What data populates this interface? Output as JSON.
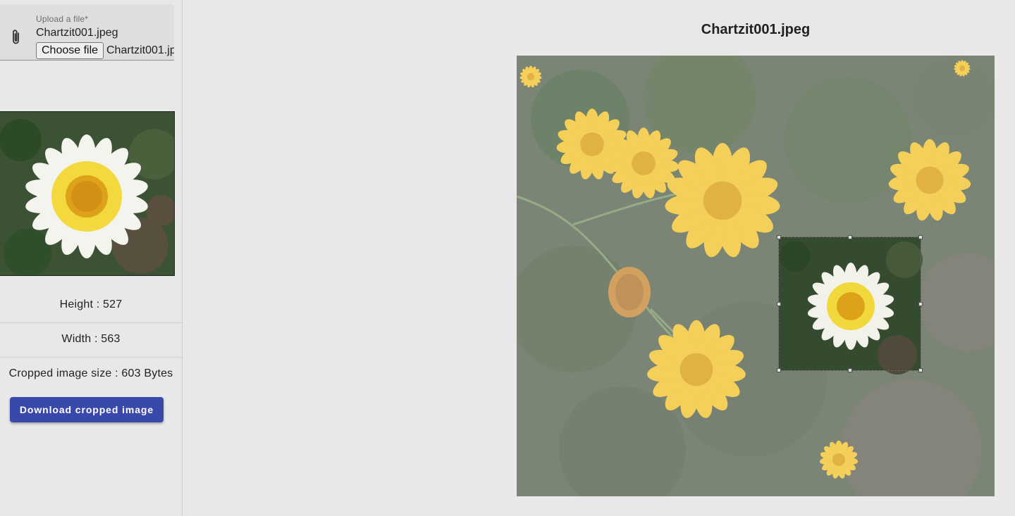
{
  "upload": {
    "label": "Upload a file*",
    "filename": "Chartzit001.jpeg",
    "choose_button": "Choose file",
    "chosen_file": "Chartzit001.jpeg"
  },
  "info": {
    "height": "Height : 527",
    "width": "Width : 563",
    "size": "Cropped image size : 603 Bytes"
  },
  "actions": {
    "download_label": "Download cropped image"
  },
  "editor": {
    "title": "Chartzit001.jpeg"
  },
  "icons": {
    "attach": "paperclip-icon"
  },
  "colors": {
    "accent": "#3949ab",
    "background": "#e8e8e8",
    "flower_petal": "#f3c33a",
    "flower_center": "#e0a511"
  }
}
